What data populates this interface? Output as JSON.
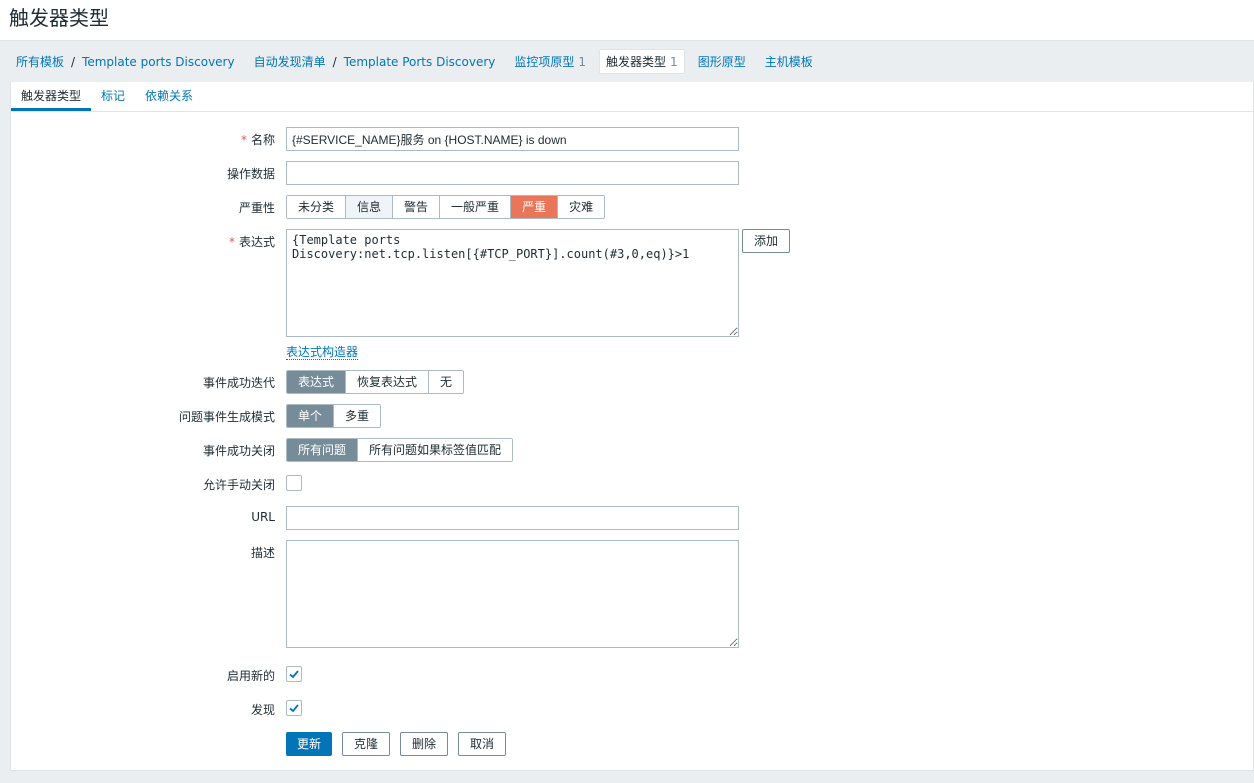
{
  "page_title": "触发器类型",
  "breadcrumb": {
    "all_templates": "所有模板",
    "template1": "Template ports Discovery",
    "discovery_list": "自动发现清单",
    "template2": "Template Ports Discovery",
    "item_prototypes": "监控项原型",
    "item_prototypes_count": "1",
    "trigger_prototypes": "触发器类型",
    "trigger_prototypes_count": "1",
    "graph_prototypes": "图形原型",
    "host_templates": "主机模板"
  },
  "tabs": [
    "触发器类型",
    "标记",
    "依赖关系"
  ],
  "form": {
    "name_label": "名称",
    "name_value": "{#SERVICE_NAME}服务 on {HOST.NAME} is down",
    "opdata_label": "操作数据",
    "opdata_value": "",
    "severity_label": "严重性",
    "severity_options": [
      "未分类",
      "信息",
      "警告",
      "一般严重",
      "严重",
      "灾难"
    ],
    "severity_selected": "严重",
    "expression_label": "表达式",
    "expression_value": "{Template ports\nDiscovery:net.tcp.listen[{#TCP_PORT}].count(#3,0,eq)}>1",
    "add_button": "添加",
    "expression_builder": "表达式构造器",
    "ok_event_gen_label": "事件成功迭代",
    "ok_event_gen_options": [
      "表达式",
      "恢复表达式",
      "无"
    ],
    "problem_mode_label": "问题事件生成模式",
    "problem_mode_options": [
      "单个",
      "多重"
    ],
    "ok_close_label": "事件成功关闭",
    "ok_close_options": [
      "所有问题",
      "所有问题如果标签值匹配"
    ],
    "manual_close_label": "允许手动关闭",
    "url_label": "URL",
    "url_value": "",
    "description_label": "描述",
    "description_value": "",
    "enabled_label": "启用新的",
    "discover_label": "发现"
  },
  "buttons": {
    "update": "更新",
    "clone": "克隆",
    "delete": "删除",
    "cancel": "取消"
  },
  "colors": {
    "accent": "#0275b8",
    "severity_high": "#e97659",
    "required": "#e45959"
  }
}
